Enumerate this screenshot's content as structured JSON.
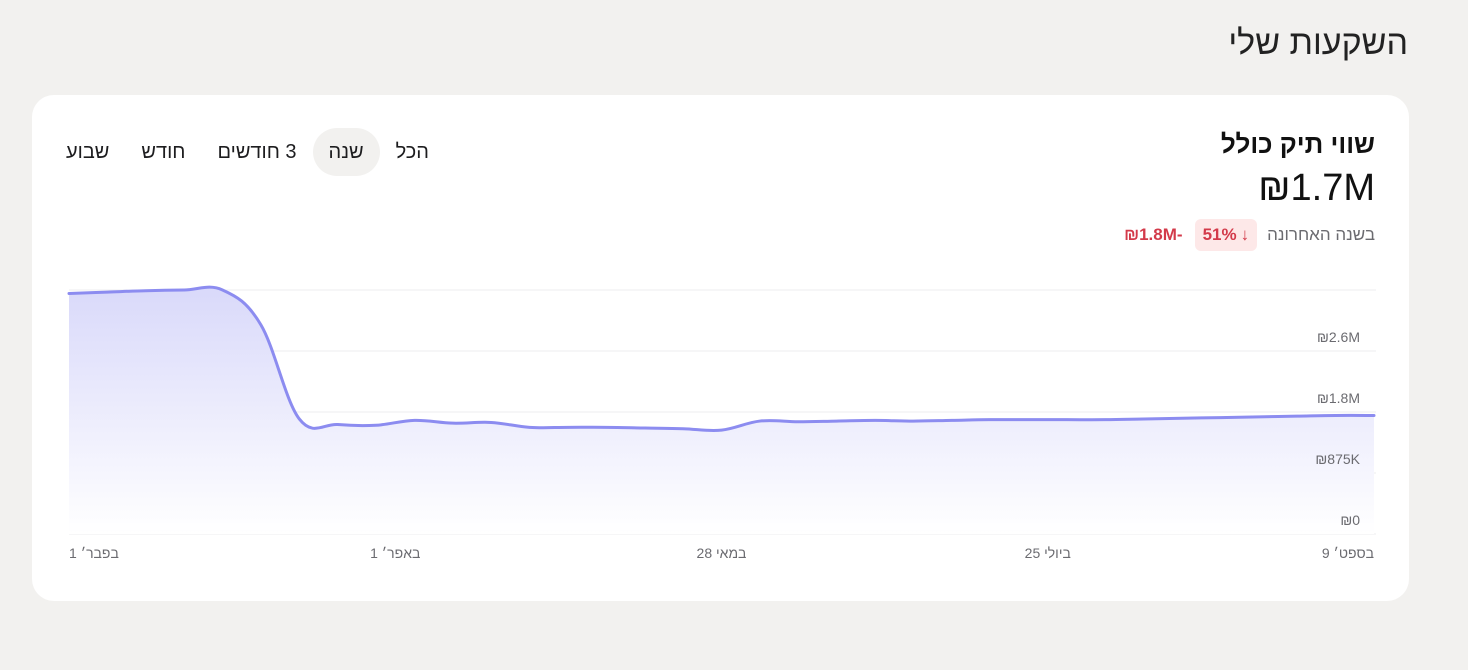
{
  "page": {
    "title": "השקעות שלי"
  },
  "summary": {
    "title": "שווי תיק כולל",
    "value": "₪1.7M",
    "change_label": "בשנה האחרונה",
    "change_percent": "51%",
    "change_arrow": "↓",
    "change_amount": "-₪1.8M"
  },
  "range_tabs": [
    {
      "label": "שבוע",
      "active": false
    },
    {
      "label": "חודש",
      "active": false
    },
    {
      "label": "3 חודשים",
      "active": false
    },
    {
      "label": "שנה",
      "active": true
    },
    {
      "label": "הכל",
      "active": false
    }
  ],
  "colors": {
    "line": "#8c8cf0",
    "fill": "#dcdcfb",
    "negative": "#d33a4a",
    "negative_bg": "#fde8e8"
  },
  "chart_data": {
    "type": "area",
    "x_ticks": [
      "1 בפבר׳",
      "1 באפר׳",
      "28 במאי",
      "25 ביולי",
      "9 בספט׳"
    ],
    "y_ticks": [
      "₪0",
      "₪875K",
      "₪1.8M",
      "₪2.6M"
    ],
    "ylim": [
      0,
      3500000
    ],
    "series": [
      {
        "values": [
          3450000,
          3470000,
          3490000,
          3500000,
          3500000,
          3000000,
          1650000,
          1570000,
          1560000,
          1630000,
          1590000,
          1600000,
          1530000,
          1530000,
          1530000,
          1520000,
          1510000,
          1490000,
          1620000,
          1610000,
          1620000,
          1630000,
          1620000,
          1630000,
          1640000,
          1640000,
          1640000,
          1640000,
          1650000,
          1660000,
          1670000,
          1680000,
          1690000,
          1700000,
          1700000
        ]
      }
    ]
  }
}
